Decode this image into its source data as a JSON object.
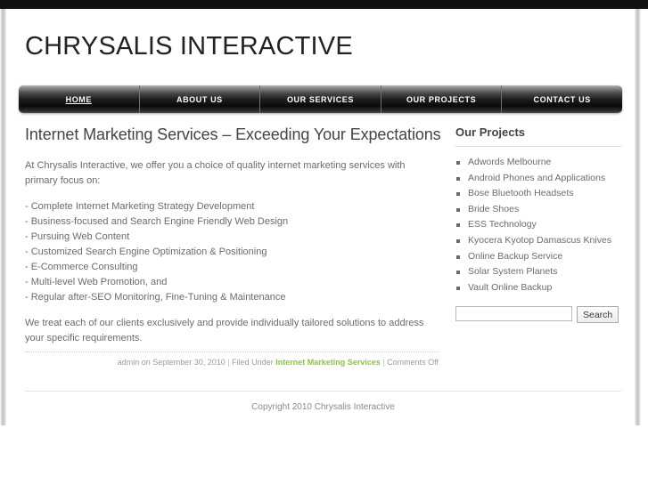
{
  "header": {
    "site_title": "CHRYSALIS INTERACTIVE"
  },
  "nav": {
    "items": [
      {
        "label": "HOME",
        "active": true
      },
      {
        "label": "ABOUT US",
        "active": false
      },
      {
        "label": "OUR SERVICES",
        "active": false
      },
      {
        "label": "OUR PROJECTS",
        "active": false
      },
      {
        "label": "CONTACT US",
        "active": false
      }
    ]
  },
  "content": {
    "post_title": "Internet Marketing Services – Exceeding Your Expectations",
    "intro": "At Chrysalis Interactive, we offer you a choice of quality internet marketing services with primary focus on:",
    "bullets": [
      "- Complete Internet Marketing Strategy Development",
      "- Business-focused and Search Engine Friendly Web Design",
      "- Pursuing Web Content",
      "- Customized Search Engine Optimization & Positioning",
      "- E-Commerce Consulting",
      "- Multi-level Web Promotion, and",
      "- Regular after-SEO Monitoring, Fine-Tuning & Maintenance"
    ],
    "closing": "We treat each of our clients exclusively and provide individually tailored solutions to address your specific requirements.",
    "meta": {
      "author_date": "admin on September 30, 2010",
      "sep1": "|",
      "filed_under_label": "Filed Under",
      "category_link": "Internet Marketing Services",
      "sep2": "|",
      "comments": "Comments Off"
    }
  },
  "sidebar": {
    "title": "Our Projects",
    "projects": [
      "Adwords Melbourne",
      "Android Phones and Applications",
      "Bose Bluetooth Headsets",
      "Bride Shoes",
      "ESS Technology",
      "Kyocera Kyotop Damascus Knives",
      "Online Backup Service",
      "Solar System Planets",
      "Vault Online Backup"
    ],
    "search": {
      "value": "",
      "placeholder": "",
      "button_label": "Search"
    }
  },
  "footer": {
    "copyright": "Copyright 2010 Chrysalis Interactive"
  },
  "colors": {
    "accent_link": "#8cc63e",
    "nav_dark": "#0a0a0a",
    "text": "#6b6b6b",
    "heading": "#444444"
  }
}
